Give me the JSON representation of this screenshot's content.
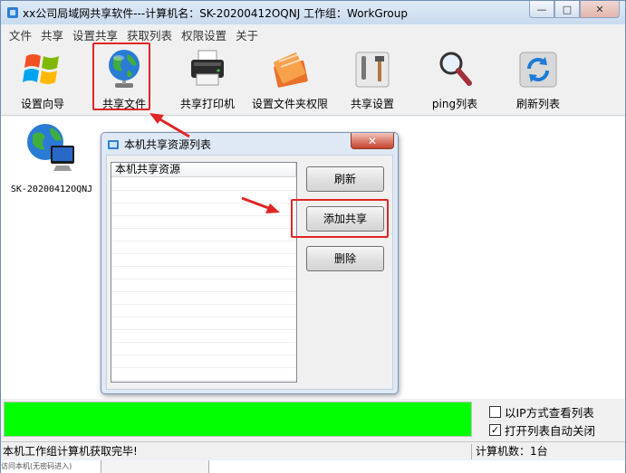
{
  "window": {
    "title": "xx公司局域网共享软件---计算机名：SK-20200412OQNJ 工作组：WorkGroup",
    "minimize_symbol": "—",
    "maximize_symbol": "□",
    "close_symbol": "✕"
  },
  "menubar": {
    "items": [
      "文件",
      "共享",
      "设置共享",
      "获取列表",
      "权限设置",
      "关于"
    ]
  },
  "toolbar": {
    "items": [
      {
        "label": "设置向导",
        "icon": "windows-logo-icon"
      },
      {
        "label": "共享文件",
        "icon": "globe-icon"
      },
      {
        "label": "共享打印机",
        "icon": "printer-icon"
      },
      {
        "label": "设置文件夹权限",
        "icon": "folder-permission-icon"
      },
      {
        "label": "共享设置",
        "icon": "settings-tools-icon"
      },
      {
        "label": "ping列表",
        "icon": "magnifier-icon"
      },
      {
        "label": "刷新列表",
        "icon": "refresh-icon"
      }
    ]
  },
  "main": {
    "computer_name": "SK-20200412OQNJ"
  },
  "dialog": {
    "title": "本机共享资源列表",
    "close_symbol": "✕",
    "list_header": "本机共享资源",
    "buttons": {
      "refresh": "刷新",
      "add": "添加共享",
      "delete": "删除"
    }
  },
  "options": {
    "ip_view": {
      "label": "以IP方式查看列表",
      "checked": false
    },
    "auto_close": {
      "label": "打开列表自动关闭",
      "checked": true,
      "mark": "✓"
    }
  },
  "status": {
    "left": "本机工作组计算机获取完毕!",
    "right": "计算机数：1台"
  },
  "below": {
    "text": "访问本机(无密码进入)"
  },
  "colors": {
    "progress": "#00ff00",
    "highlight": "#e02525"
  }
}
